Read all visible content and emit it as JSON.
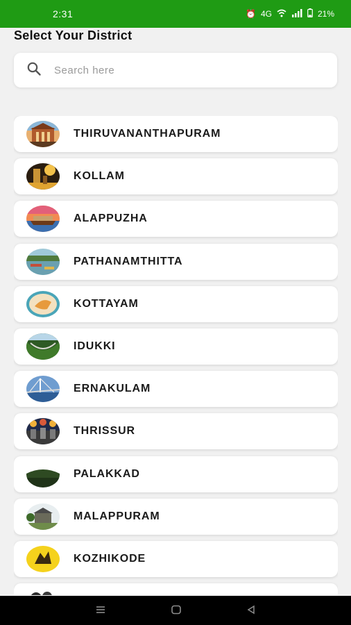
{
  "status_bar": {
    "time": "2:31",
    "network": "4G",
    "battery": "21%"
  },
  "page": {
    "title": "Select Your District"
  },
  "search": {
    "placeholder": "Search here"
  },
  "districts": [
    {
      "name": "THIRUVANANTHAPURAM",
      "thumb": "building"
    },
    {
      "name": "KOLLAM",
      "thumb": "lighthouse-night"
    },
    {
      "name": "ALAPPUZHA",
      "thumb": "houseboat"
    },
    {
      "name": "PATHANAMTHITTA",
      "thumb": "river"
    },
    {
      "name": "KOTTAYAM",
      "thumb": "emblem"
    },
    {
      "name": "IDUKKI",
      "thumb": "dam"
    },
    {
      "name": "ERNAKULAM",
      "thumb": "bridge"
    },
    {
      "name": "THRISSUR",
      "thumb": "festival"
    },
    {
      "name": "PALAKKAD",
      "thumb": "fort"
    },
    {
      "name": "MALAPPURAM",
      "thumb": "monument"
    },
    {
      "name": "KOZHIKODE",
      "thumb": "yellow-emblem"
    },
    {
      "name": "",
      "thumb": "partial"
    }
  ],
  "colors": {
    "status_bar": "#1f9b14",
    "background": "#f1f1f1",
    "nav_bar": "#000000"
  }
}
